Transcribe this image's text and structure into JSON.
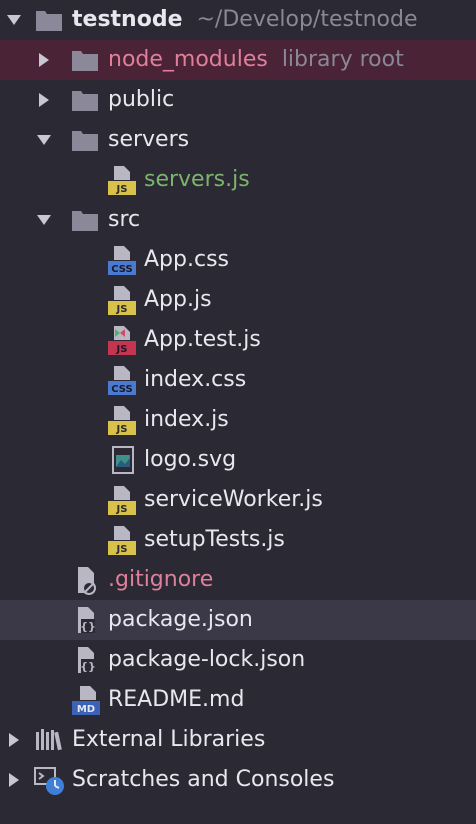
{
  "project": {
    "name": "testnode",
    "path": "~/Develop/testnode"
  },
  "items": {
    "node_modules": {
      "name": "node_modules",
      "note": "library root"
    },
    "public": "public",
    "servers": "servers",
    "servers_js": "servers.js",
    "src": "src",
    "app_css": "App.css",
    "app_js": "App.js",
    "app_test_js": "App.test.js",
    "index_css": "index.css",
    "index_js": "index.js",
    "logo_svg": "logo.svg",
    "service_worker": "serviceWorker.js",
    "setup_tests": "setupTests.js",
    "gitignore": ".gitignore",
    "package_json": "package.json",
    "package_lock": "package-lock.json",
    "readme": "README.md",
    "external_libraries": "External Libraries",
    "scratches": "Scratches and Consoles"
  },
  "icon_tags": {
    "js": "JS",
    "css": "CSS",
    "md": "MD"
  },
  "colors": {
    "background": "#2b2934",
    "selected_row": "#3b3848",
    "node_modules_row": "#4a2436",
    "excluded_text": "#e07f9b",
    "modified_text": "#7cb46b",
    "muted_text": "#8a8796",
    "folder": "#8b889a"
  }
}
